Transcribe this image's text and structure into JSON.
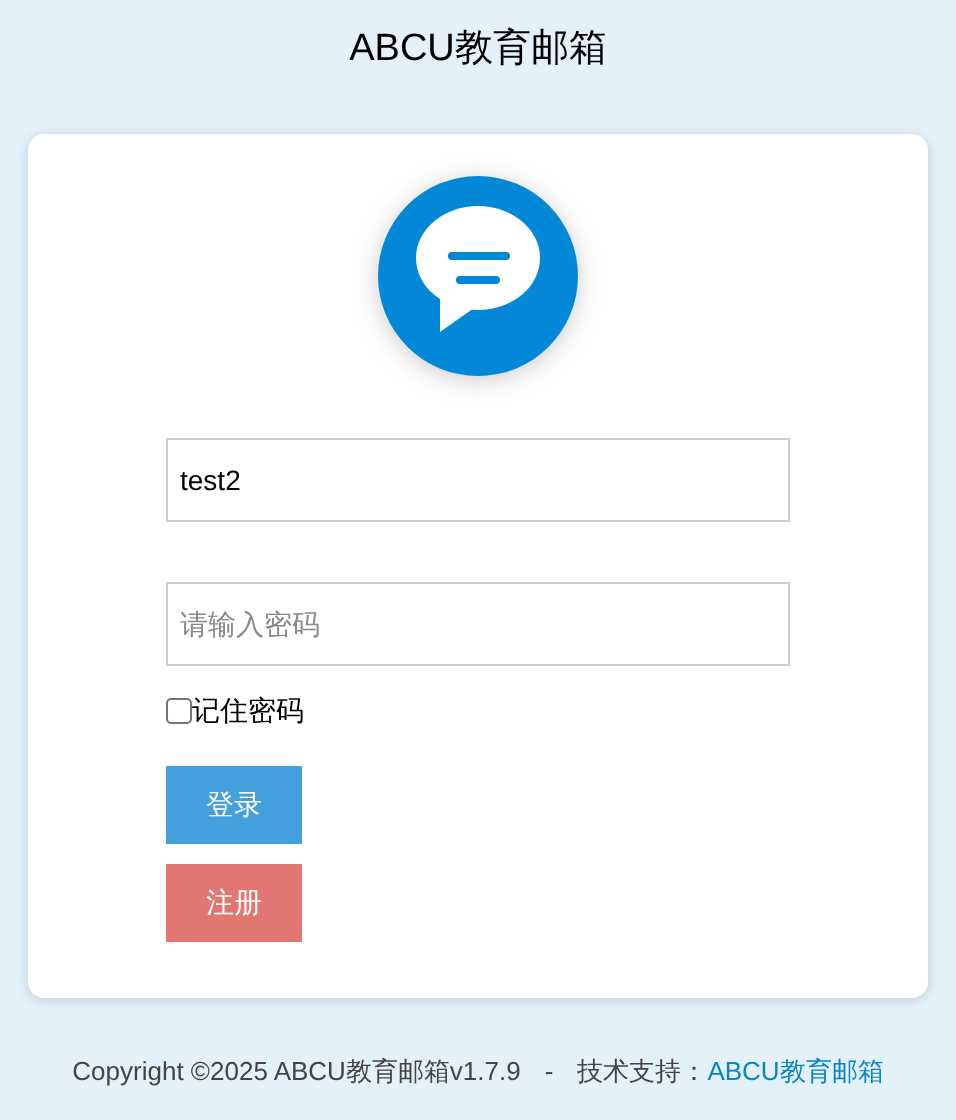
{
  "header": {
    "title": "ABCU教育邮箱"
  },
  "login_form": {
    "username": {
      "value": "test2"
    },
    "password": {
      "placeholder": "请输入密码"
    },
    "remember": {
      "label": "记住密码",
      "checked": false
    },
    "buttons": [
      {
        "label": "登录",
        "kind": "primary"
      },
      {
        "label": "注册",
        "kind": "danger"
      }
    ]
  },
  "footer": {
    "copyright": "Copyright ©2025 ABCU教育邮箱v1.7.9",
    "separator": "-",
    "support_label": "技术支持：",
    "support_link": "ABCU教育邮箱"
  }
}
